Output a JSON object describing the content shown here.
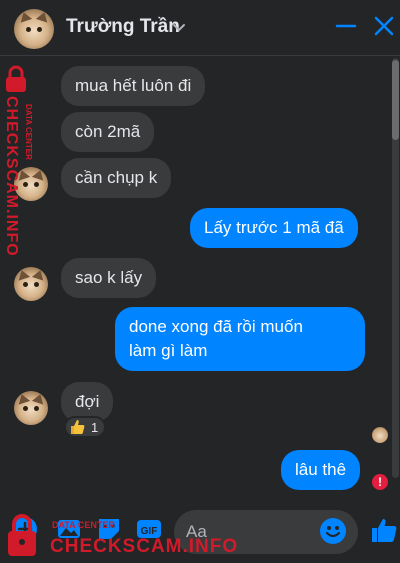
{
  "header": {
    "name": "Trường Trần"
  },
  "messages": [
    {
      "side": "in",
      "text": "mua hết luôn đi"
    },
    {
      "side": "in",
      "text": "còn 2mã"
    },
    {
      "side": "in",
      "text": "cần chụp k"
    },
    {
      "side": "out",
      "text": "Lấy trước 1 mã đã"
    },
    {
      "side": "in",
      "text": "sao k lấy"
    },
    {
      "side": "out",
      "line1": "done xong đã rồi muốn",
      "line2": "làm gì làm"
    },
    {
      "side": "in",
      "text": "đợi",
      "reaction_count": "1"
    },
    {
      "side": "out",
      "text": "lâu thê"
    }
  ],
  "composer": {
    "placeholder": "Aa"
  },
  "watermark": {
    "small": "DATA CENTER",
    "main": "CHECKSCAM.INFO"
  },
  "colors": {
    "background": "#242526",
    "incoming_bubble": "#3a3b3c",
    "outgoing_bubble": "#0084ff",
    "accent": "#0084ff",
    "watermark": "#d11a2a"
  },
  "icons": [
    "chevron-down-icon",
    "minimize-icon",
    "close-icon",
    "thumbs-up-icon",
    "plus-icon",
    "image-icon",
    "sticker-icon",
    "gif-icon",
    "emoji-icon",
    "like-icon",
    "error-icon",
    "lock-icon"
  ]
}
